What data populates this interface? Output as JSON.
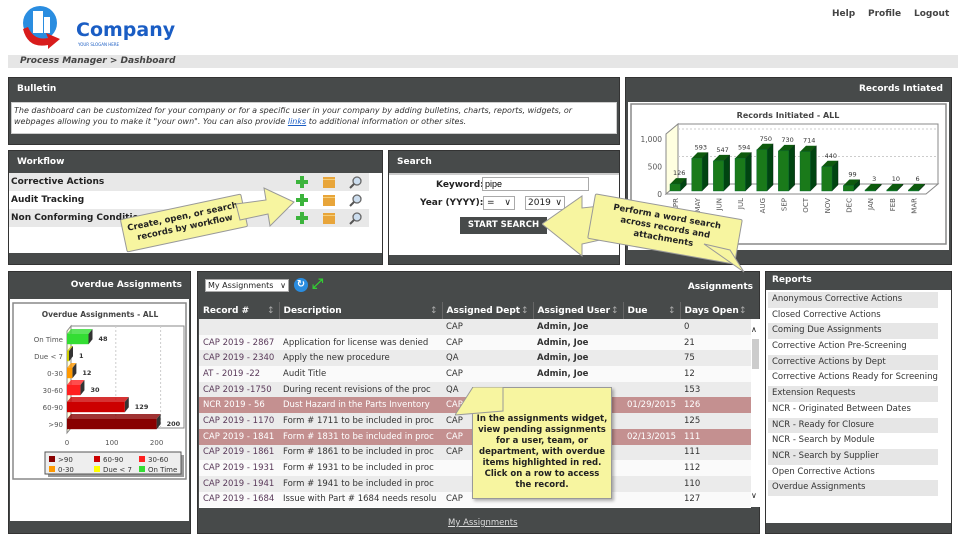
{
  "header": {
    "logo_text": "Company",
    "logo_tagline": "YOUR SLOGAN HERE",
    "links": [
      "Help",
      "Profile",
      "Logout"
    ],
    "breadcrumb": "Process Manager > Dashboard"
  },
  "bulletin": {
    "title": "Bulletin",
    "text_before_link": "The dashboard can be customized for your company or for a specific user in your company by adding bulletins, charts, reports, widgets, or webpages allowing you to make it \"your own\". You can also provide ",
    "link_text": "links",
    "text_after_link": " to additional information or other sites."
  },
  "workflow": {
    "title": "Workflow",
    "items": [
      "Corrective Actions",
      "Audit Tracking",
      "Non Conforming Condition"
    ],
    "callout": "Create, open, or search records by workflow"
  },
  "search": {
    "title": "Search",
    "keyword_label": "Keyword:",
    "keyword_value": "pipe",
    "year_label": "Year (YYYY):",
    "operator_value": "=",
    "year_value": "2019",
    "button_label": "START SEARCH",
    "callout": "Perform a word search across records and attachments"
  },
  "records_panel": {
    "title": "Records Intiated"
  },
  "overdue_panel": {
    "title": "Overdue Assignments"
  },
  "assignments": {
    "title": "Assignments",
    "filter_value": "My Assignments",
    "footer_link": "My Assignments",
    "columns": [
      "Record #",
      "Description",
      "Assigned Dept",
      "Assigned User",
      "Due",
      "Days Open"
    ],
    "rows": [
      {
        "record": "",
        "desc": "",
        "dept": "CAP",
        "user": "Admin, Joe",
        "due": "",
        "days": "0",
        "overdue": false
      },
      {
        "record": "CAP 2019 - 2867",
        "desc": "Application for license was denied",
        "dept": "CAP",
        "user": "Admin, Joe",
        "due": "",
        "days": "21",
        "overdue": false
      },
      {
        "record": "CAP 2019 - 2340",
        "desc": "Apply the new procedure",
        "dept": "QA",
        "user": "Admin, Joe",
        "due": "",
        "days": "75",
        "overdue": false
      },
      {
        "record": "AT - 2019 -22",
        "desc": "Audit Title",
        "dept": "CAP",
        "user": "Admin, Joe",
        "due": "",
        "days": "12",
        "overdue": false
      },
      {
        "record": "CAP 2019 -1750",
        "desc": "During recent revisions of the proc",
        "dept": "QA",
        "user": "",
        "due": "",
        "days": "153",
        "overdue": false
      },
      {
        "record": "NCR 2019 - 56",
        "desc": "Dust Hazard in the Parts Inventory",
        "dept": "CAP",
        "user": "",
        "due": "01/29/2015",
        "days": "126",
        "overdue": true
      },
      {
        "record": "CAP 2019 - 1170",
        "desc": "Form # 1711 to be included in proc",
        "dept": "CAP",
        "user": "",
        "due": "",
        "days": "125",
        "overdue": false
      },
      {
        "record": "CAP 2019 - 1841",
        "desc": "Form # 1831 to be included in proc",
        "dept": "CAP",
        "user": "",
        "due": "02/13/2015",
        "days": "111",
        "overdue": true
      },
      {
        "record": "CAP 2019 - 1861",
        "desc": "Form # 1861 to be included in proc",
        "dept": "CAP",
        "user": "",
        "due": "",
        "days": "111",
        "overdue": false
      },
      {
        "record": "CAP 2019 - 1931",
        "desc": "Form # 1931 to be included in proc",
        "dept": "",
        "user": "",
        "due": "",
        "days": "112",
        "overdue": false
      },
      {
        "record": "CAP 2019 - 1941",
        "desc": "Form # 1941 to be included in proc",
        "dept": "",
        "user": "",
        "due": "",
        "days": "110",
        "overdue": false
      },
      {
        "record": "CAP 2019 - 1684",
        "desc": "Issue with Part # 1684 needs resolu",
        "dept": "CAP",
        "user": "",
        "due": "",
        "days": "127",
        "overdue": false
      }
    ],
    "callout": "In the assignments widget, view pending assignments for a user, team, or department, with overdue items highlighted in red. Click on a row to access the record."
  },
  "reports": {
    "title": "Reports",
    "items": [
      "Anonymous Corrective Actions",
      "Closed Corrective Actions",
      "Coming Due Assignments",
      "Corrective Action Pre-Screening",
      "Corrective Actions by Dept",
      "Corrective Actions Ready for Screening",
      "Extension Requests",
      "NCR - Originated Between Dates",
      "NCR - Ready for Closure",
      "NCR - Search by Module",
      "NCR - Search by Supplier",
      "Open Corrective Actions",
      "Overdue Assignments"
    ]
  },
  "colors": {
    "panel_header": "#474a4a",
    "overdue_row": "#c49090",
    "callout": "#f7f5a0",
    "bar_green": "#1a7a1a"
  },
  "chart_data": [
    {
      "type": "bar",
      "title": "Records Initiated - ALL",
      "categories": [
        "APR",
        "MAY",
        "JUN",
        "JUL",
        "AUG",
        "SEP",
        "OCT",
        "NOV",
        "DEC",
        "JAN",
        "FEB",
        "MAR"
      ],
      "values": [
        126,
        593,
        547,
        594,
        750,
        730,
        714,
        440,
        99,
        3,
        10,
        6
      ],
      "yticks": [
        "0",
        "500",
        "1,000"
      ],
      "ylim": [
        0,
        1000
      ],
      "xlabel": "",
      "ylabel": ""
    },
    {
      "type": "bar",
      "orientation": "horizontal",
      "title": "Overdue Assignments - ALL",
      "categories": [
        "On Time",
        "Due < 7",
        "0-30",
        "30-60",
        "60-90",
        ">90"
      ],
      "values": [
        48,
        1,
        12,
        30,
        129,
        200
      ],
      "colors": [
        "#33dd33",
        "#cccc00",
        "#ff9900",
        "#ff2020",
        "#cc0000",
        "#880000"
      ],
      "xticks": [
        "0",
        "100",
        "200"
      ],
      "xlim": [
        0,
        250
      ],
      "legend": [
        ">90",
        "60-90",
        "30-60",
        "0-30",
        "Due < 7",
        "On Time"
      ],
      "legend_colors": [
        "#880000",
        "#cc0000",
        "#ff2020",
        "#ff9900",
        "#ffff00",
        "#33dd33"
      ],
      "legend_position": "bottom"
    }
  ]
}
